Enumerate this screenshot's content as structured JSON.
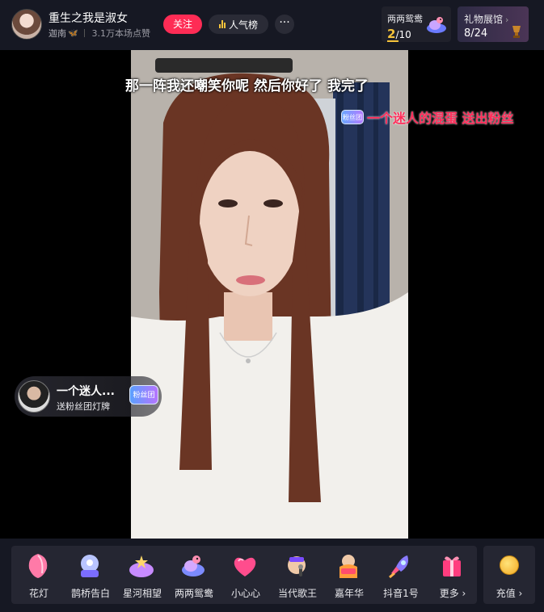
{
  "header": {
    "streamer_name": "重生之我是淑女",
    "location": "迦南",
    "likes_text": "3.1万本场点赞",
    "follow_label": "关注",
    "rank_label": "人气榜",
    "more_label": "···"
  },
  "task_card": {
    "label": "两两鸳鸯",
    "current": "2",
    "total": "/10",
    "progress": 0.2
  },
  "gallery_card": {
    "label": "礼物展馆",
    "arrow": "›",
    "count": "8/24"
  },
  "live": {
    "subtitle": "那一阵我还嘲笑你呢 然后你好了 我完了",
    "gift_banner_badge": "粉丝团",
    "gift_banner_text": "一个迷人的混蛋 送出粉丝"
  },
  "fan_toast": {
    "name": "一个迷人...",
    "text": "送粉丝团灯牌",
    "badge": "粉丝团"
  },
  "gifts": [
    {
      "label": "花灯",
      "icon": "lantern-icon"
    },
    {
      "label": "鹊桥告白",
      "icon": "magpie-bridge-icon"
    },
    {
      "label": "星河相望",
      "icon": "star-river-icon"
    },
    {
      "label": "两两鸳鸯",
      "icon": "mandarin-duck-icon"
    },
    {
      "label": "小心心",
      "icon": "heart-icon"
    },
    {
      "label": "当代歌王",
      "icon": "singer-king-icon"
    },
    {
      "label": "嘉年华",
      "icon": "carnival-icon"
    },
    {
      "label": "抖音1号",
      "icon": "rocket-icon"
    },
    {
      "label": "更多 ›",
      "icon": "gift-box-icon"
    }
  ],
  "recharge": {
    "label": "充值 ›",
    "icon": "coin-icon"
  },
  "colors": {
    "accent": "#fe2c55",
    "gold": "#f5c33b",
    "panel": "#252632",
    "header_bg": "#161823"
  }
}
